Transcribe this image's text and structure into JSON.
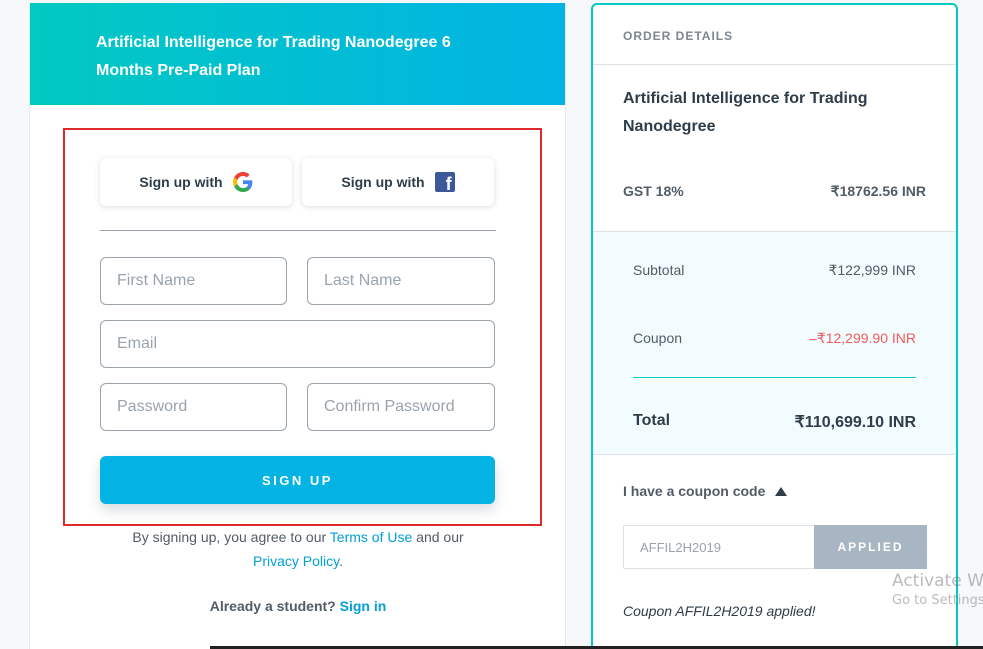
{
  "header": {
    "program_title": "Artificial Intelligence for Trading Nanodegree 6 Months Pre-Paid Plan"
  },
  "signup": {
    "google_label": "Sign up with",
    "facebook_label": "Sign up with",
    "first_name_placeholder": "First Name",
    "last_name_placeholder": "Last Name",
    "email_placeholder": "Email",
    "password_placeholder": "Password",
    "confirm_password_placeholder": "Confirm Password",
    "submit_label": "SIGN UP",
    "agree_prefix": "By signing up, you agree to our ",
    "terms_link": "Terms of Use",
    "agree_mid": " and our",
    "privacy_link": "Privacy Policy",
    "agree_suffix": ".",
    "already_text": "Already a student? ",
    "signin_link": "Sign in"
  },
  "order": {
    "title": "ORDER DETAILS",
    "product": "Artificial Intelligence for Trading Nanodegree",
    "gst_label": "GST 18%",
    "gst_value": "₹18762.56 INR",
    "subtotal_label": "Subtotal",
    "subtotal_value": "₹122,999 INR",
    "coupon_label": "Coupon",
    "coupon_value": "–₹12,299.90 INR",
    "total_label": "Total",
    "total_value": "₹110,699.10 INR",
    "coupon_toggle": "I have a coupon code",
    "coupon_code": "AFFIL2H2019",
    "applied_label": "APPLIED",
    "coupon_message": "Coupon AFFIL2H2019 applied!"
  },
  "watermark": {
    "line1": "Activate W",
    "line2": "Go to Settings"
  },
  "colors": {
    "accent": "#02b3e4",
    "teal": "#02c9c2",
    "discount": "#f15b5b",
    "highlight": "#dd2b2b"
  },
  "icons": {
    "google": "google-icon",
    "facebook": "facebook-icon",
    "caret": "caret-up-icon"
  }
}
